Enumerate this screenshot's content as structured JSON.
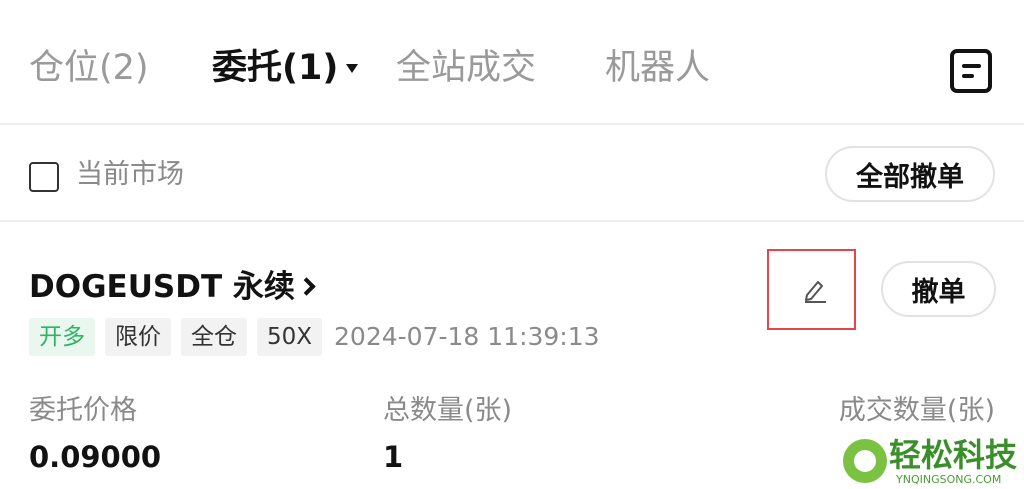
{
  "tabs": [
    {
      "label": "仓位(2)"
    },
    {
      "label": "委托(1)"
    },
    {
      "label": "全站成交"
    },
    {
      "label": "机器人"
    }
  ],
  "filter": {
    "current_market_label": "当前市场",
    "current_market_checked": false,
    "cancel_all_label": "全部撤单"
  },
  "order": {
    "symbol": "DOGEUSDT 永续",
    "tags": {
      "side": "开多",
      "type": "限价",
      "margin": "全仓",
      "leverage": "50X"
    },
    "timestamp": "2024-07-18 11:39:13",
    "cancel_label": "撤单",
    "fields": {
      "price_label": "委托价格",
      "price_value": "0.09000",
      "quantity_label": "总数量(张)",
      "quantity_value": "1",
      "filled_label": "成交数量(张)"
    }
  },
  "watermark": {
    "title": "轻松科技",
    "subtitle": "YNQINGSONG.COM"
  },
  "colors": {
    "long_green": "#2fb466",
    "highlight_red": "#e5454a",
    "muted_text": "#8a8a8a"
  },
  "icons": [
    "chevron-down-icon",
    "document-icon",
    "chevron-right-icon",
    "edit-pencil-icon",
    "checkbox-icon",
    "logo-icon"
  ]
}
